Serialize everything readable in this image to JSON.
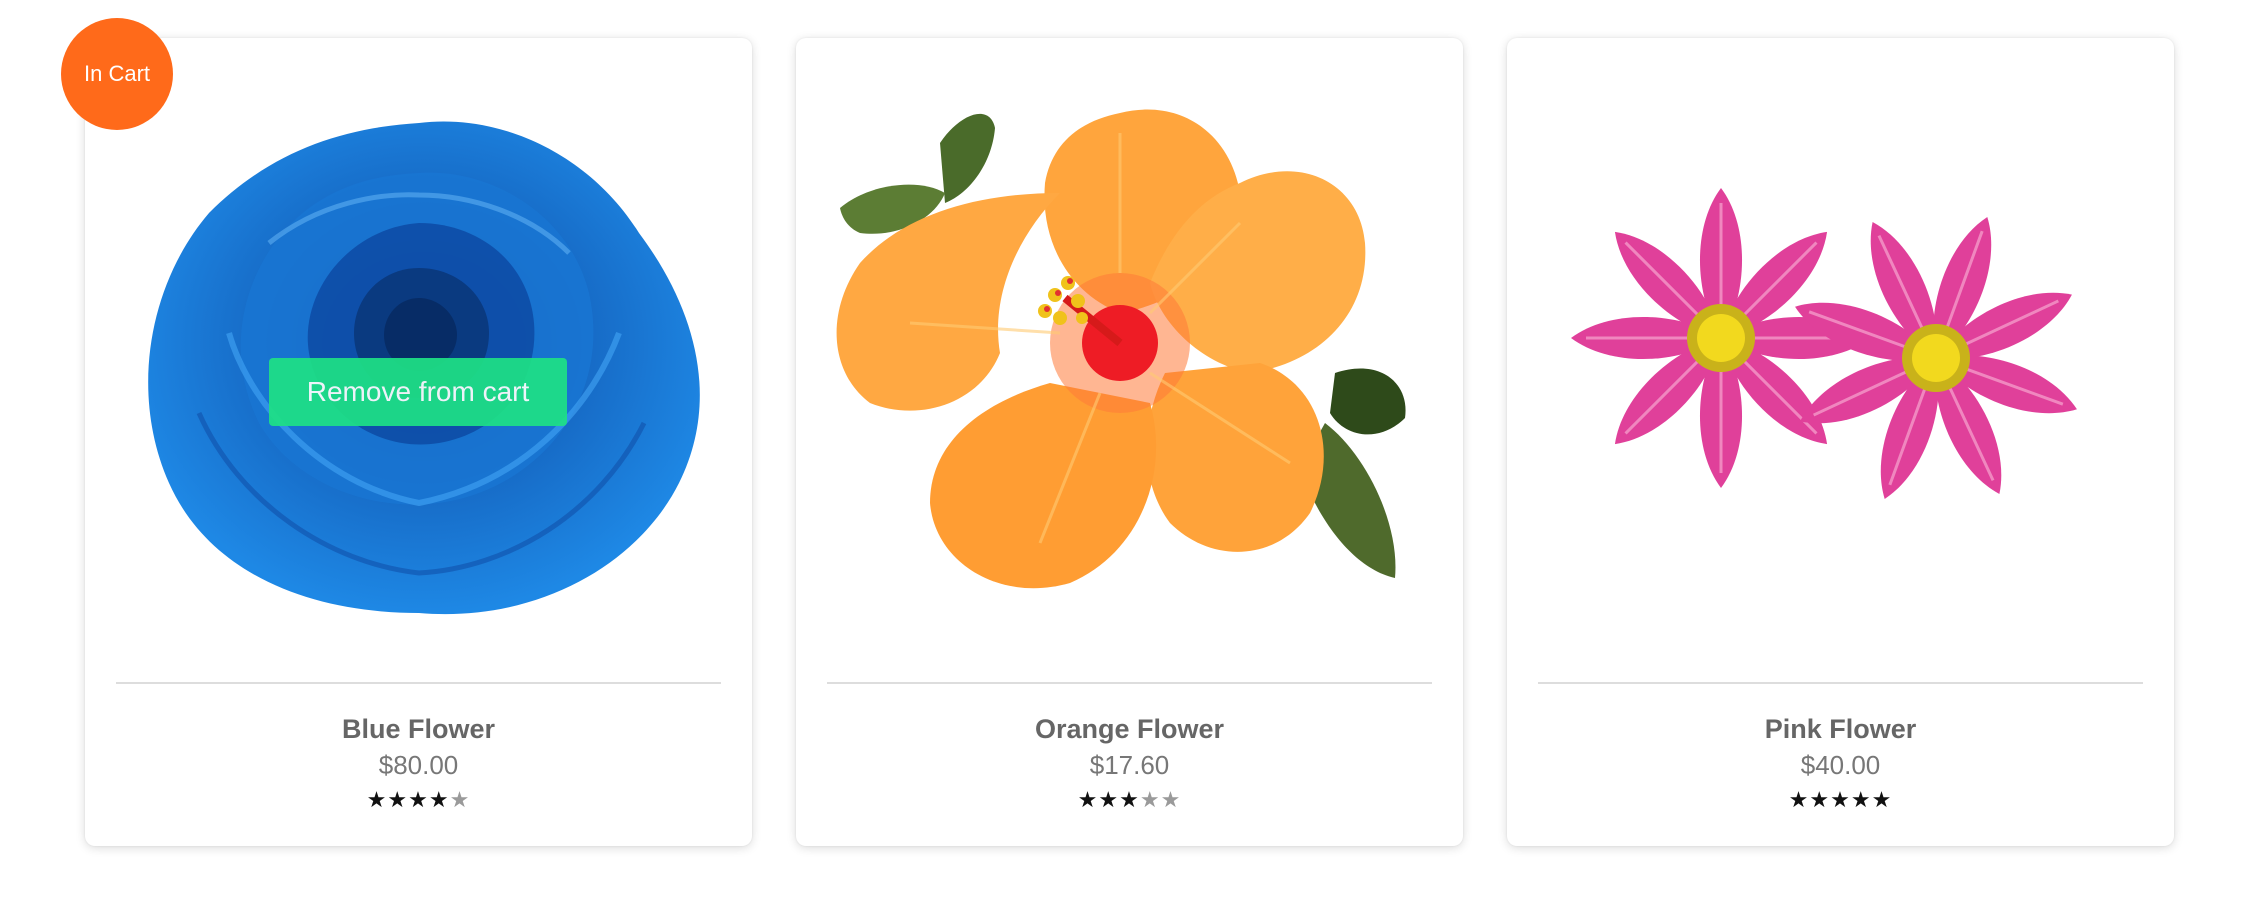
{
  "products": [
    {
      "name": "Blue Flower",
      "price": "$80.00",
      "rating": 4,
      "max_rating": 5,
      "in_cart": true,
      "badge_label": "In Cart",
      "remove_label": "Remove from cart",
      "color": "#1a73c8",
      "image_icon": "blue-rose-image"
    },
    {
      "name": "Orange Flower",
      "price": "$17.60",
      "rating": 3,
      "max_rating": 5,
      "in_cart": false,
      "color": "#ffa53d",
      "image_icon": "orange-hibiscus-image"
    },
    {
      "name": "Pink Flower",
      "price": "$40.00",
      "rating": 5,
      "max_rating": 5,
      "in_cart": false,
      "color": "#e0409a",
      "image_icon": "pink-cosmos-image"
    }
  ],
  "colors": {
    "badge": "#ff6a1a",
    "remove_button": "#1ee086",
    "star_filled": "#111111",
    "star_empty": "#9a9a9a"
  }
}
